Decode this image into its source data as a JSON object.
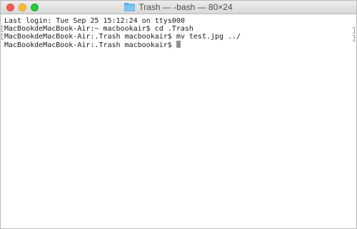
{
  "window": {
    "title": "Trash — -bash — 80×24",
    "folder_icon": "folder-icon"
  },
  "terminal": {
    "lines": [
      "Last login: Tue Sep 25 15:12:24 on ttys000",
      "MacBookdeMacBook-Air:~ macbookair$ cd .Trash",
      "MacBookdeMacBook-Air:.Trash macbookair$ mv test.jpg ../",
      "MacBookdeMacBook-Air:.Trash macbookair$ "
    ],
    "cursor_color": "#8f8f8f"
  },
  "colors": {
    "close": "#fc5b57",
    "minimize": "#fdbc2e",
    "zoom": "#28c840",
    "folder": "#5fb3f0"
  }
}
